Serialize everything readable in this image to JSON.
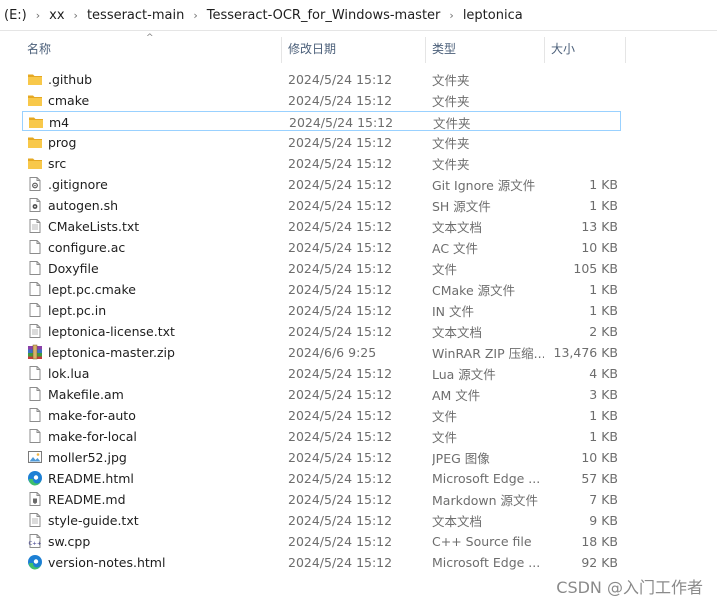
{
  "breadcrumb": [
    "(E:)",
    "xx",
    "tesseract-main",
    "Tesseract-OCR_for_Windows-master",
    "leptonica"
  ],
  "breadcrumb_separator": "›",
  "columns": {
    "name": "名称",
    "date": "修改日期",
    "type": "类型",
    "size": "大小"
  },
  "sort_indicator": "^",
  "selected_index": 2,
  "files": [
    {
      "name": ".github",
      "date": "2024/5/24 15:12",
      "type": "文件夹",
      "size": "",
      "icon": "folder-icon"
    },
    {
      "name": "cmake",
      "date": "2024/5/24 15:12",
      "type": "文件夹",
      "size": "",
      "icon": "folder-icon"
    },
    {
      "name": "m4",
      "date": "2024/5/24 15:12",
      "type": "文件夹",
      "size": "",
      "icon": "folder-icon"
    },
    {
      "name": "prog",
      "date": "2024/5/24 15:12",
      "type": "文件夹",
      "size": "",
      "icon": "folder-icon"
    },
    {
      "name": "src",
      "date": "2024/5/24 15:12",
      "type": "文件夹",
      "size": "",
      "icon": "folder-icon"
    },
    {
      "name": ".gitignore",
      "date": "2024/5/24 15:12",
      "type": "Git Ignore 源文件",
      "size": "1 KB",
      "icon": "gear-file-icon"
    },
    {
      "name": "autogen.sh",
      "date": "2024/5/24 15:12",
      "type": "SH 源文件",
      "size": "1 KB",
      "icon": "script-file-icon"
    },
    {
      "name": "CMakeLists.txt",
      "date": "2024/5/24 15:12",
      "type": "文本文档",
      "size": "13 KB",
      "icon": "text-file-icon"
    },
    {
      "name": "configure.ac",
      "date": "2024/5/24 15:12",
      "type": "AC 文件",
      "size": "10 KB",
      "icon": "blank-file-icon"
    },
    {
      "name": "Doxyfile",
      "date": "2024/5/24 15:12",
      "type": "文件",
      "size": "105 KB",
      "icon": "blank-file-icon"
    },
    {
      "name": "lept.pc.cmake",
      "date": "2024/5/24 15:12",
      "type": "CMake 源文件",
      "size": "1 KB",
      "icon": "blank-file-icon"
    },
    {
      "name": "lept.pc.in",
      "date": "2024/5/24 15:12",
      "type": "IN 文件",
      "size": "1 KB",
      "icon": "blank-file-icon"
    },
    {
      "name": "leptonica-license.txt",
      "date": "2024/5/24 15:12",
      "type": "文本文档",
      "size": "2 KB",
      "icon": "text-file-icon"
    },
    {
      "name": "leptonica-master.zip",
      "date": "2024/6/6 9:25",
      "type": "WinRAR ZIP 压缩...",
      "size": "13,476 KB",
      "icon": "winrar-archive-icon"
    },
    {
      "name": "lok.lua",
      "date": "2024/5/24 15:12",
      "type": "Lua 源文件",
      "size": "4 KB",
      "icon": "blank-file-icon"
    },
    {
      "name": "Makefile.am",
      "date": "2024/5/24 15:12",
      "type": "AM 文件",
      "size": "3 KB",
      "icon": "blank-file-icon"
    },
    {
      "name": "make-for-auto",
      "date": "2024/5/24 15:12",
      "type": "文件",
      "size": "1 KB",
      "icon": "blank-file-icon"
    },
    {
      "name": "make-for-local",
      "date": "2024/5/24 15:12",
      "type": "文件",
      "size": "1 KB",
      "icon": "blank-file-icon"
    },
    {
      "name": "moller52.jpg",
      "date": "2024/5/24 15:12",
      "type": "JPEG 图像",
      "size": "10 KB",
      "icon": "image-file-icon"
    },
    {
      "name": "README.html",
      "date": "2024/5/24 15:12",
      "type": "Microsoft Edge ...",
      "size": "57 KB",
      "icon": "edge-icon"
    },
    {
      "name": "README.md",
      "date": "2024/5/24 15:12",
      "type": "Markdown 源文件",
      "size": "7 KB",
      "icon": "markdown-file-icon"
    },
    {
      "name": "style-guide.txt",
      "date": "2024/5/24 15:12",
      "type": "文本文档",
      "size": "9 KB",
      "icon": "text-file-icon"
    },
    {
      "name": "sw.cpp",
      "date": "2024/5/24 15:12",
      "type": "C++ Source file",
      "size": "18 KB",
      "icon": "cpp-file-icon"
    },
    {
      "name": "version-notes.html",
      "date": "2024/5/24 15:12",
      "type": "Microsoft Edge ...",
      "size": "92 KB",
      "icon": "edge-icon"
    }
  ],
  "watermark": "CSDN @入门工作者",
  "colors": {
    "folder": "#f8c84a",
    "folder_dark": "#e5a823",
    "selection_border": "#99d1ff",
    "header_text": "#4c607a",
    "edge_blue": "#1c7fd4",
    "edge_green": "#3fbf6c"
  }
}
